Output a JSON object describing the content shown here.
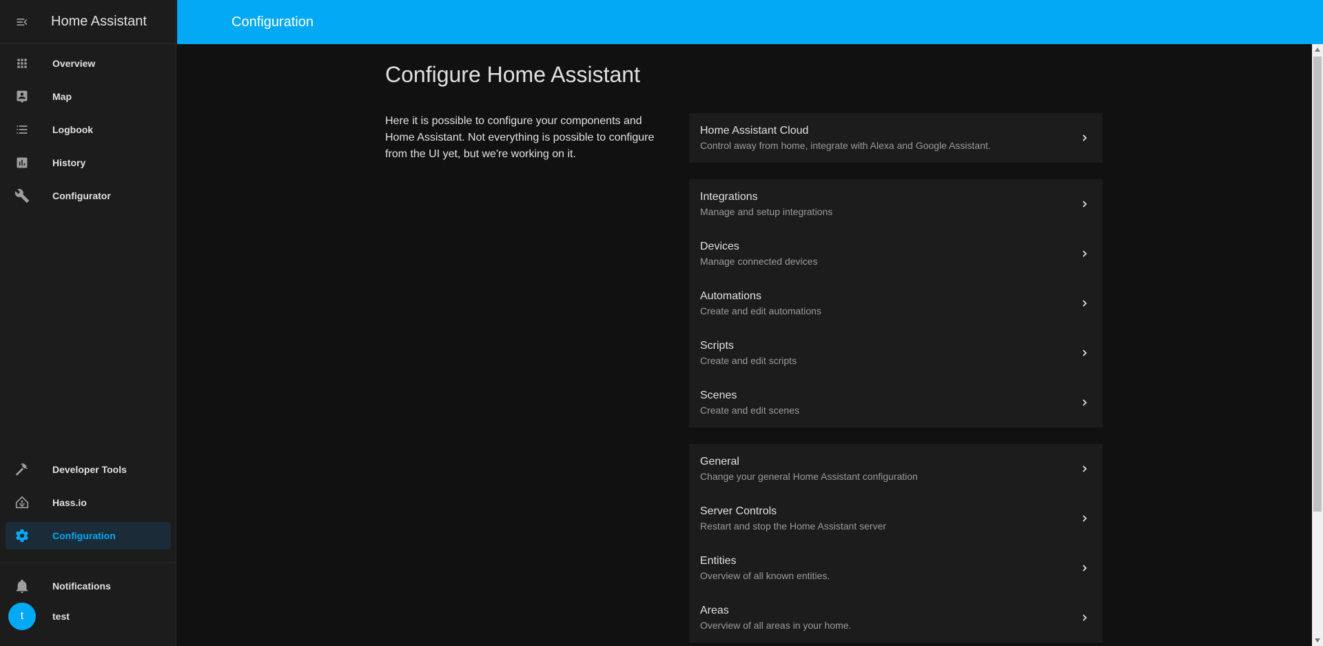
{
  "sidebar": {
    "title": "Home Assistant",
    "items": [
      {
        "label": "Overview",
        "icon": "grid-icon"
      },
      {
        "label": "Map",
        "icon": "map-account-icon"
      },
      {
        "label": "Logbook",
        "icon": "list-icon"
      },
      {
        "label": "History",
        "icon": "chart-box-icon"
      },
      {
        "label": "Configurator",
        "icon": "wrench-icon"
      }
    ],
    "bottom_items": [
      {
        "label": "Developer Tools",
        "icon": "hammer-icon"
      },
      {
        "label": "Hass.io",
        "icon": "home-assistant-icon"
      },
      {
        "label": "Configuration",
        "icon": "gear-icon",
        "active": true
      }
    ],
    "notifications_label": "Notifications",
    "user": {
      "initial": "t",
      "name": "test"
    }
  },
  "topbar": {
    "title": "Configuration"
  },
  "main": {
    "heading": "Configure Home Assistant",
    "intro": "Here it is possible to configure your components and Home Assistant. Not everything is possible to configure from the UI yet, but we're working on it.",
    "cards": [
      [
        {
          "title": "Home Assistant Cloud",
          "subtitle": "Control away from home, integrate with Alexa and Google Assistant."
        }
      ],
      [
        {
          "title": "Integrations",
          "subtitle": "Manage and setup integrations"
        },
        {
          "title": "Devices",
          "subtitle": "Manage connected devices"
        },
        {
          "title": "Automations",
          "subtitle": "Create and edit automations"
        },
        {
          "title": "Scripts",
          "subtitle": "Create and edit scripts"
        },
        {
          "title": "Scenes",
          "subtitle": "Create and edit scenes"
        }
      ],
      [
        {
          "title": "General",
          "subtitle": "Change your general Home Assistant configuration"
        },
        {
          "title": "Server Controls",
          "subtitle": "Restart and stop the Home Assistant server"
        },
        {
          "title": "Entities",
          "subtitle": "Overview of all known entities."
        },
        {
          "title": "Areas",
          "subtitle": "Overview of all areas in your home."
        }
      ]
    ]
  },
  "colors": {
    "accent": "#03a9f4",
    "sidebar_bg": "#1c1c1c",
    "main_bg": "#111111",
    "card_bg": "#1c1c1c",
    "active_bg": "#1b2b38"
  }
}
